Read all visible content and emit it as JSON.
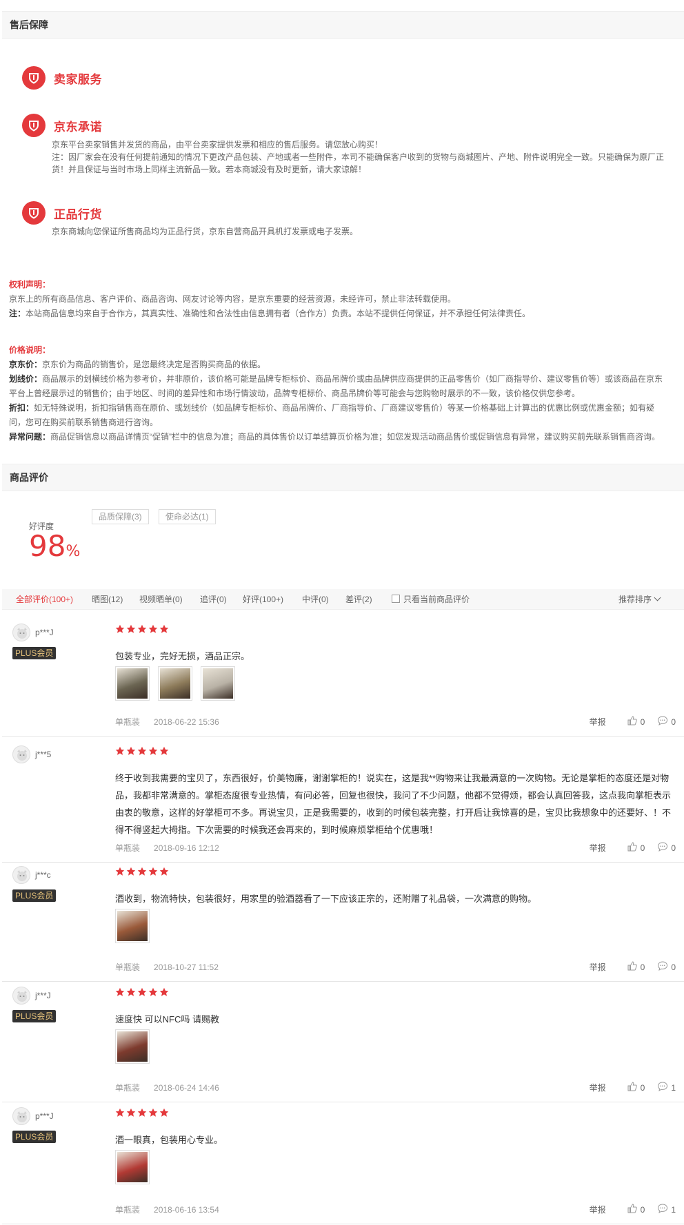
{
  "after_sales": {
    "header": "售后保障",
    "services": [
      {
        "title": "卖家服务",
        "lines": []
      },
      {
        "title": "京东承诺",
        "lines": [
          "京东平台卖家销售并发货的商品，由平台卖家提供发票和相应的售后服务。请您放心购买！",
          "注：因厂家会在没有任何提前通知的情况下更改产品包装、产地或者一些附件，本司不能确保客户收到的货物与商城图片、产地、附件说明完全一致。只能确保为原厂正货！并且保证与当时市场上同样主流新品一致。若本商城没有及时更新，请大家谅解！"
        ]
      },
      {
        "title": "正品行货",
        "lines": [
          "京东商城向您保证所售商品均为正品行货，京东自营商品开具机打发票或电子发票。"
        ]
      }
    ]
  },
  "rights": {
    "title": "权利声明：",
    "line1": "京东上的所有商品信息、客户评价、商品咨询、网友讨论等内容，是京东重要的经营资源，未经许可，禁止非法转载使用。",
    "line2_label": "注：",
    "line2": "本站商品信息均来自于合作方，其真实性、准确性和合法性由信息拥有者（合作方）负责。本站不提供任何保证，并不承担任何法律责任。"
  },
  "price": {
    "title": "价格说明：",
    "items": [
      {
        "label": "京东价：",
        "text": "京东价为商品的销售价，是您最终决定是否购买商品的依据。"
      },
      {
        "label": "划线价：",
        "text": "商品展示的划横线价格为参考价，并非原价，该价格可能是品牌专柜标价、商品吊牌价或由品牌供应商提供的正品零售价（如厂商指导价、建议零售价等）或该商品在京东平台上曾经展示过的销售价；由于地区、时间的差异性和市场行情波动，品牌专柜标价、商品吊牌价等可能会与您购物时展示的不一致，该价格仅供您参考。"
      },
      {
        "label": "折扣：",
        "text": "如无特殊说明，折扣指销售商在原价、或划线价（如品牌专柜标价、商品吊牌价、厂商指导价、厂商建议零售价）等某一价格基础上计算出的优惠比例或优惠金额；如有疑问，您可在购买前联系销售商进行咨询。"
      },
      {
        "label": "异常问题：",
        "text": "商品促销信息以商品详情页“促销”栏中的信息为准；商品的具体售价以订单结算页价格为准；如您发现活动商品售价或促销信息有异常，建议购买前先联系销售商咨询。"
      }
    ]
  },
  "reviews_section": {
    "header": "商品评价",
    "good_rate_label": "好评度",
    "good_rate_value": "98",
    "good_rate_unit": "%",
    "tags": [
      "品质保障(3)",
      "使命必达(1)"
    ],
    "filters": [
      "全部评价(100+)",
      "晒图(12)",
      "视频晒单(0)",
      "追评(0)",
      "好评(100+)",
      "中评(0)",
      "差评(2)"
    ],
    "only_current_label": "只看当前商品评价",
    "sort_label": "推荐排序",
    "report_label": "举报",
    "plus_label": "PLUS会员"
  },
  "reviews": [
    {
      "user": "p***J",
      "plus": true,
      "rating": 5,
      "text": "包装专业，完好无损，酒品正宗。",
      "images": 3,
      "variant": "单瓶装",
      "date": "2018-06-22 15:36",
      "likes": "0",
      "replies": "0"
    },
    {
      "user": "j***5",
      "plus": false,
      "rating": 5,
      "text": "终于收到我需要的宝贝了，东西很好，价美物廉，谢谢掌柜的！说实在，这是我**购物来让我最满意的一次购物。无论是掌柜的态度还是对物品，我都非常满意的。掌柜态度很专业热情，有问必答，回复也很快，我问了不少问题，他都不觉得烦，都会认真回答我，这点我向掌柜表示由衷的敬意，这样的好掌柜可不多。再说宝贝，正是我需要的，收到的时候包装完整，打开后让我惊喜的是，宝贝比我想象中的还要好、！不得不得竖起大拇指。下次需要的时候我还会再来的，到时候麻烦掌柜给个优惠哦！",
      "images": 0,
      "variant": "单瓶装",
      "date": "2018-09-16 12:12",
      "likes": "0",
      "replies": "0"
    },
    {
      "user": "j***c",
      "plus": true,
      "rating": 5,
      "text": "酒收到，物流特快，包装很好，用家里的验酒器看了一下应该正宗的，还附赠了礼品袋，一次满意的购物。",
      "images": 1,
      "variant": "单瓶装",
      "date": "2018-10-27 11:52",
      "likes": "0",
      "replies": "0"
    },
    {
      "user": "j***J",
      "plus": true,
      "rating": 5,
      "text": "速度快 可以NFC吗 请赐教",
      "images": 1,
      "variant": "单瓶装",
      "date": "2018-06-24 14:46",
      "likes": "0",
      "replies": "1"
    },
    {
      "user": "p***J",
      "plus": true,
      "rating": 5,
      "text": "酒一眼真，包装用心专业。",
      "images": 1,
      "variant": "单瓶装",
      "date": "2018-06-16 13:54",
      "likes": "0",
      "replies": "1"
    }
  ],
  "colors": {
    "accent": "#e4393c",
    "header_bg": "#f7f7f7",
    "plus_bg": "#323232",
    "plus_text": "#e6c27a"
  }
}
